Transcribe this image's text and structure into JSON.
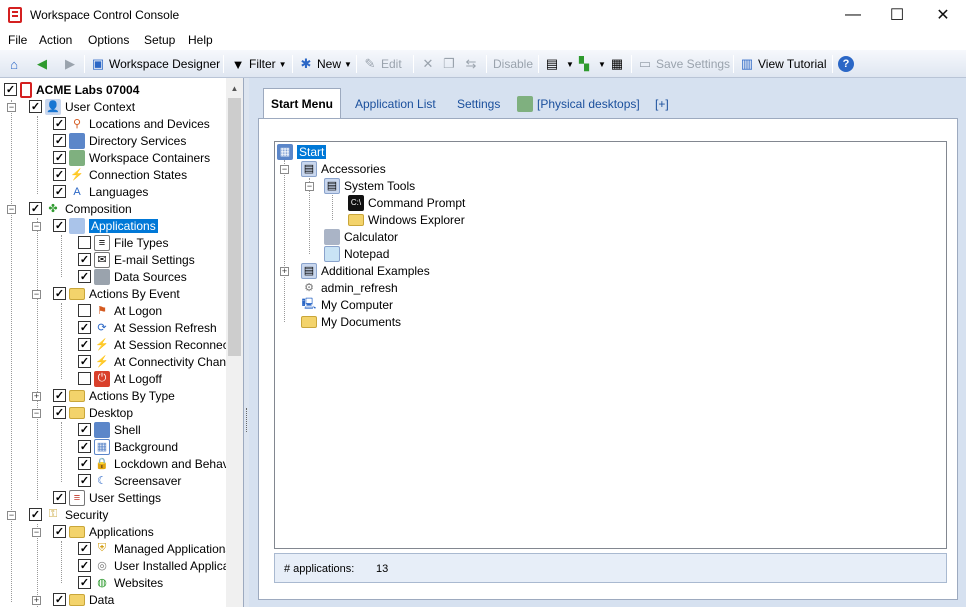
{
  "window": {
    "title": "Workspace Control Console",
    "minimize": "—",
    "maximize": "☐",
    "close": "✕"
  },
  "menu": [
    "File",
    "Action",
    "Options",
    "Setup",
    "Help"
  ],
  "toolbar": {
    "workspace_designer": "Workspace Designer",
    "filter": "Filter",
    "new": "New",
    "edit": "Edit",
    "disable": "Disable",
    "save_settings": "Save Settings",
    "view_tutorial": "View Tutorial"
  },
  "left_tree": {
    "root": "ACME Labs 07004",
    "user_context": "User Context",
    "locations": "Locations and Devices",
    "directory": "Directory Services",
    "containers": "Workspace Containers",
    "connection_states": "Connection States",
    "languages": "Languages",
    "composition": "Composition",
    "applications": "Applications",
    "file_types": "File Types",
    "email_settings": "E-mail Settings",
    "data_sources": "Data Sources",
    "actions_by_event": "Actions By Event",
    "at_logon": "At Logon",
    "at_session_refresh": "At Session Refresh",
    "at_session_reconnect": "At Session Reconnect",
    "at_connectivity_change": "At Connectivity Change",
    "at_logoff": "At Logoff",
    "actions_by_type": "Actions By Type",
    "desktop": "Desktop",
    "shell": "Shell",
    "background": "Background",
    "lockdown": "Lockdown and Behavior",
    "screensaver": "Screensaver",
    "user_settings": "User Settings",
    "security": "Security",
    "sec_applications": "Applications",
    "managed_apps": "Managed Applications",
    "user_installed": "User Installed Applications",
    "websites": "Websites",
    "data": "Data"
  },
  "tabs": {
    "start_menu": "Start Menu",
    "application_list": "Application List",
    "settings": "Settings",
    "physical_desktops": "[Physical desktops]",
    "more": "[+]"
  },
  "start_tree": {
    "start": "Start",
    "accessories": "Accessories",
    "system_tools": "System Tools",
    "command_prompt": "Command Prompt",
    "windows_explorer": "Windows Explorer",
    "calculator": "Calculator",
    "notepad": "Notepad",
    "additional_examples": "Additional Examples",
    "admin_refresh": "admin_refresh",
    "my_computer": "My Computer",
    "my_documents": "My Documents"
  },
  "status": {
    "label": "# applications:",
    "value": "13"
  },
  "colors": {
    "selection": "#0078d7",
    "link_tab": "#1a4f9c",
    "pane_bg": "#d6e1f0"
  }
}
